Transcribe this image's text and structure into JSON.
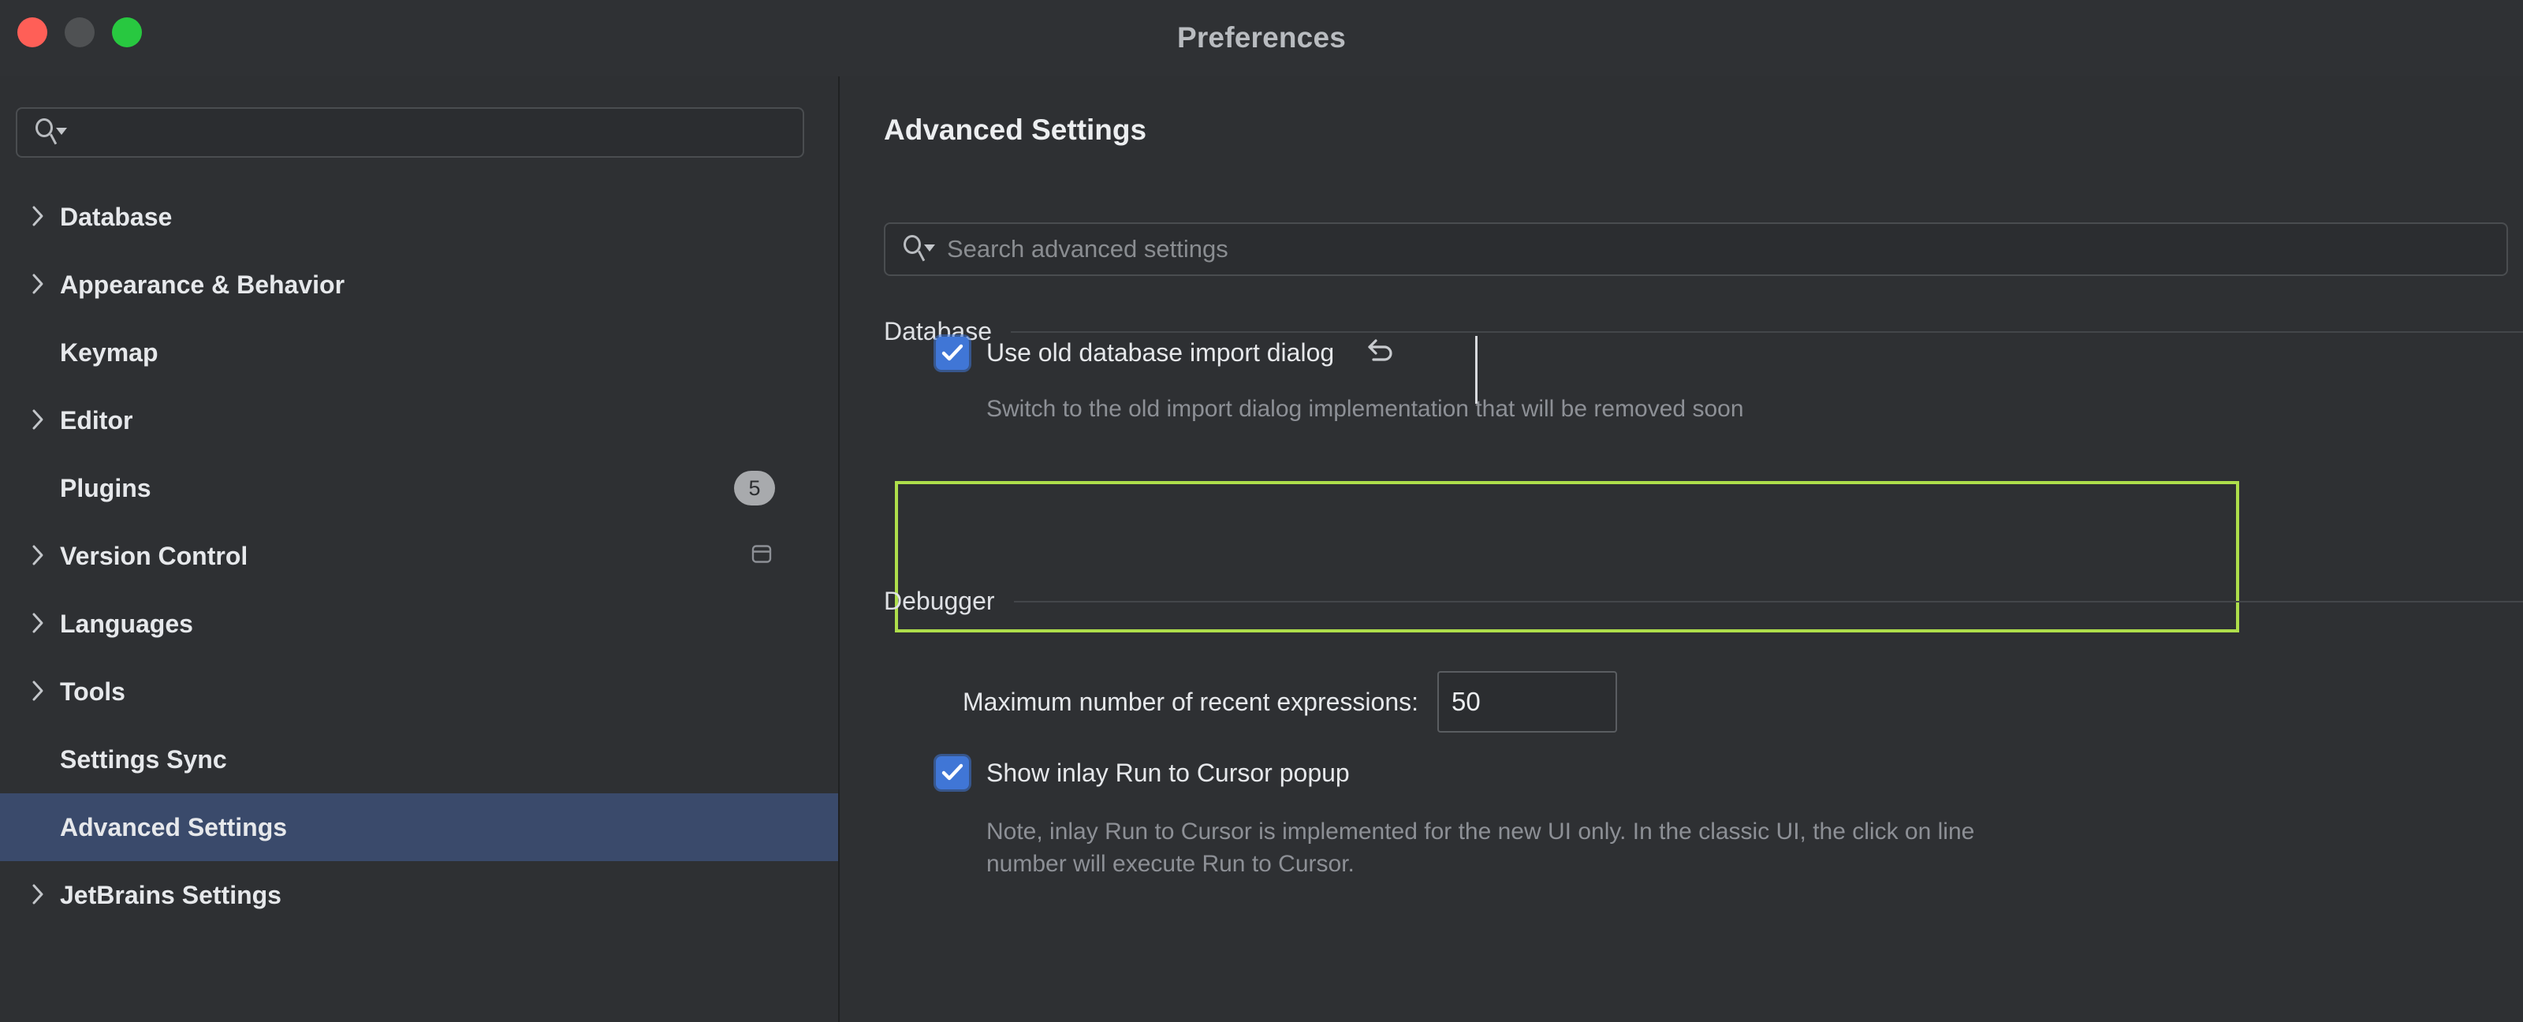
{
  "window": {
    "title": "Preferences",
    "traffic_lights": [
      {
        "name": "close",
        "color": "#ff5f57"
      },
      {
        "name": "minimize",
        "color": "#4f5153"
      },
      {
        "name": "zoom",
        "color": "#28c840"
      }
    ]
  },
  "sidebar": {
    "search": {
      "value": "",
      "placeholder": ""
    },
    "items": [
      {
        "label": "Database",
        "expandable": true,
        "selected": false
      },
      {
        "label": "Appearance & Behavior",
        "expandable": true,
        "selected": false
      },
      {
        "label": "Keymap",
        "expandable": false,
        "selected": false
      },
      {
        "label": "Editor",
        "expandable": true,
        "selected": false
      },
      {
        "label": "Plugins",
        "expandable": false,
        "selected": false,
        "badge": "5"
      },
      {
        "label": "Version Control",
        "expandable": true,
        "selected": false,
        "trailing_icon": "panel-icon"
      },
      {
        "label": "Languages",
        "expandable": true,
        "selected": false
      },
      {
        "label": "Tools",
        "expandable": true,
        "selected": false
      },
      {
        "label": "Settings Sync",
        "expandable": false,
        "selected": false
      },
      {
        "label": "Advanced Settings",
        "expandable": false,
        "selected": true
      },
      {
        "label": "JetBrains Settings",
        "expandable": true,
        "selected": false
      }
    ]
  },
  "panel": {
    "title": "Advanced Settings",
    "search": {
      "value": "",
      "placeholder": "Search advanced settings"
    },
    "groups": [
      {
        "label": "Database"
      },
      {
        "label": "Debugger"
      }
    ],
    "database": {
      "checkbox": {
        "label": "Use old database import dialog",
        "checked": true,
        "has_revert": true
      },
      "description": "Switch to the old import dialog implementation that will be removed soon",
      "highlighted": true,
      "highlight_color": "#aede4b"
    },
    "debugger": {
      "max_expressions": {
        "label": "Maximum number of recent expressions:",
        "value": "50"
      },
      "inlay_popup": {
        "label": "Show inlay Run to Cursor popup",
        "checked": true
      },
      "inlay_description": "Note, inlay Run to Cursor is implemented for the new UI only. In the classic UI, the click on line\nnumber will execute Run to Cursor."
    }
  },
  "colors": {
    "background": "#2e3033",
    "selection": "#3a4a6b",
    "accent_checkbox": "#4076d6",
    "highlight": "#aede4b",
    "text": "#e6e8eb",
    "muted_text": "#8d9096"
  }
}
